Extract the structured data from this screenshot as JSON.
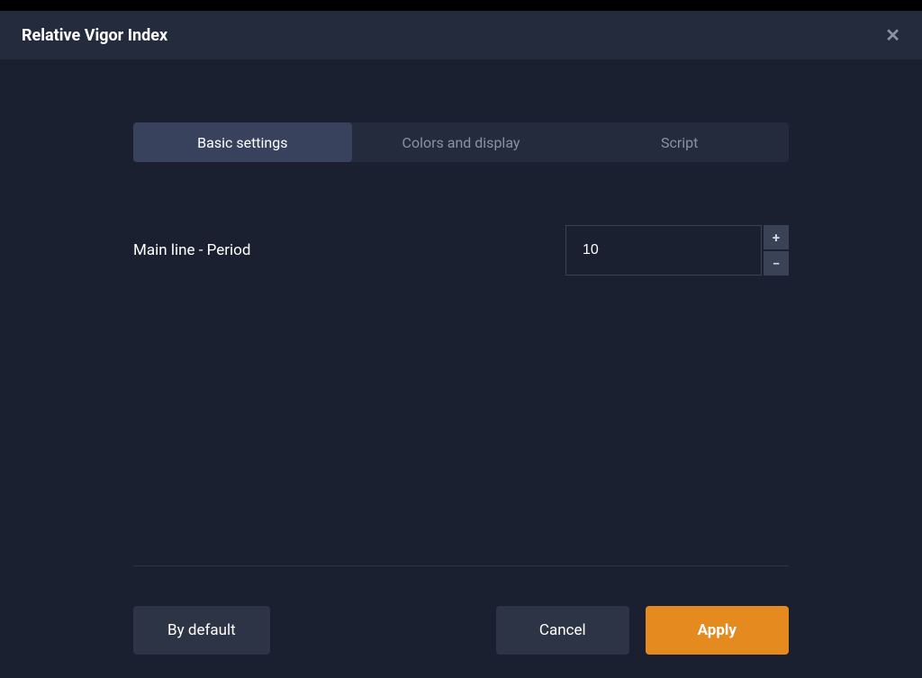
{
  "dialog": {
    "title": "Relative Vigor Index"
  },
  "tabs": [
    {
      "label": "Basic settings",
      "active": true
    },
    {
      "label": "Colors and display",
      "active": false
    },
    {
      "label": "Script",
      "active": false
    }
  ],
  "settings": {
    "main_line_period": {
      "label": "Main line - Period",
      "value": "10"
    }
  },
  "stepper": {
    "plus": "+",
    "minus": "−"
  },
  "buttons": {
    "by_default": "By default",
    "cancel": "Cancel",
    "apply": "Apply"
  }
}
